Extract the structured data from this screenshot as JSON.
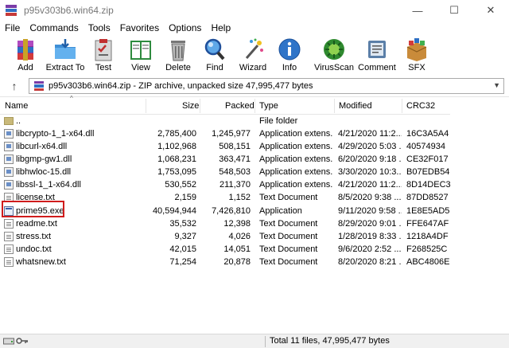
{
  "window": {
    "title": "p95v303b6.win64.zip",
    "minimize_glyph": "—",
    "maximize_glyph": "☐",
    "close_glyph": "✕"
  },
  "menu": [
    "File",
    "Commands",
    "Tools",
    "Favorites",
    "Options",
    "Help"
  ],
  "toolbar": [
    {
      "label": "Add",
      "icon": "winrar-add-icon"
    },
    {
      "label": "Extract To",
      "icon": "folder-extract-icon"
    },
    {
      "label": "Test",
      "icon": "clipboard-test-icon"
    },
    {
      "label": "View",
      "icon": "book-view-icon"
    },
    {
      "label": "Delete",
      "icon": "trash-can-icon"
    },
    {
      "label": "Find",
      "icon": "magnifier-icon"
    },
    {
      "label": "Wizard",
      "icon": "magic-wand-icon"
    },
    {
      "label": "Info",
      "icon": "info-icon"
    },
    {
      "label": "VirusScan",
      "icon": "virus-scan-icon"
    },
    {
      "label": "Comment",
      "icon": "comment-icon"
    },
    {
      "label": "SFX",
      "icon": "sfx-box-icon"
    }
  ],
  "address": {
    "up_glyph": "↑",
    "text": "p95v303b6.win64.zip - ZIP archive, unpacked size 47,995,477 bytes"
  },
  "columns": {
    "name": "Name",
    "size": "Size",
    "packed": "Packed",
    "type": "Type",
    "modified": "Modified",
    "crc": "CRC32"
  },
  "files": [
    {
      "name": "..",
      "size": "",
      "packed": "",
      "type": "File folder",
      "modified": "",
      "crc": "",
      "kind": "folder"
    },
    {
      "name": "libcrypto-1_1-x64.dll",
      "size": "2,785,400",
      "packed": "1,245,977",
      "type": "Application extens...",
      "modified": "4/21/2020 11:2...",
      "crc": "16C3A5A4",
      "kind": "dll"
    },
    {
      "name": "libcurl-x64.dll",
      "size": "1,102,968",
      "packed": "508,151",
      "type": "Application extens...",
      "modified": "4/29/2020 5:03 ...",
      "crc": "40574934",
      "kind": "dll"
    },
    {
      "name": "libgmp-gw1.dll",
      "size": "1,068,231",
      "packed": "363,471",
      "type": "Application extens...",
      "modified": "6/20/2020 9:18 ...",
      "crc": "CE32F017",
      "kind": "dll"
    },
    {
      "name": "libhwloc-15.dll",
      "size": "1,753,095",
      "packed": "548,503",
      "type": "Application extens...",
      "modified": "3/30/2020 10:3...",
      "crc": "B07EDB54",
      "kind": "dll"
    },
    {
      "name": "libssl-1_1-x64.dll",
      "size": "530,552",
      "packed": "211,370",
      "type": "Application extens...",
      "modified": "4/21/2020 11:2...",
      "crc": "8D14DEC3",
      "kind": "dll"
    },
    {
      "name": "license.txt",
      "size": "2,159",
      "packed": "1,152",
      "type": "Text Document",
      "modified": "8/5/2020 9:38 ...",
      "crc": "87DD8527",
      "kind": "txt"
    },
    {
      "name": "prime95.exe",
      "size": "40,594,944",
      "packed": "7,426,810",
      "type": "Application",
      "modified": "9/11/2020 9:58 ...",
      "crc": "1E8E5AD5",
      "kind": "exe"
    },
    {
      "name": "readme.txt",
      "size": "35,532",
      "packed": "12,398",
      "type": "Text Document",
      "modified": "8/29/2020 9:01 ...",
      "crc": "FFE647AF",
      "kind": "txt"
    },
    {
      "name": "stress.txt",
      "size": "9,327",
      "packed": "4,026",
      "type": "Text Document",
      "modified": "1/28/2019 8:33 ...",
      "crc": "1218A4DF",
      "kind": "txt"
    },
    {
      "name": "undoc.txt",
      "size": "42,015",
      "packed": "14,051",
      "type": "Text Document",
      "modified": "9/6/2020 2:52 ...",
      "crc": "F268525C",
      "kind": "txt"
    },
    {
      "name": "whatsnew.txt",
      "size": "71,254",
      "packed": "20,878",
      "type": "Text Document",
      "modified": "8/20/2020 8:21 ...",
      "crc": "ABC4806E",
      "kind": "txt"
    }
  ],
  "status": {
    "text": "Total 11 files, 47,995,477 bytes",
    "icons": [
      "drive-icon",
      "key-icon"
    ]
  },
  "colors": {
    "highlight_border": "#d01c1c",
    "header_separator": "#e5e5e5"
  }
}
